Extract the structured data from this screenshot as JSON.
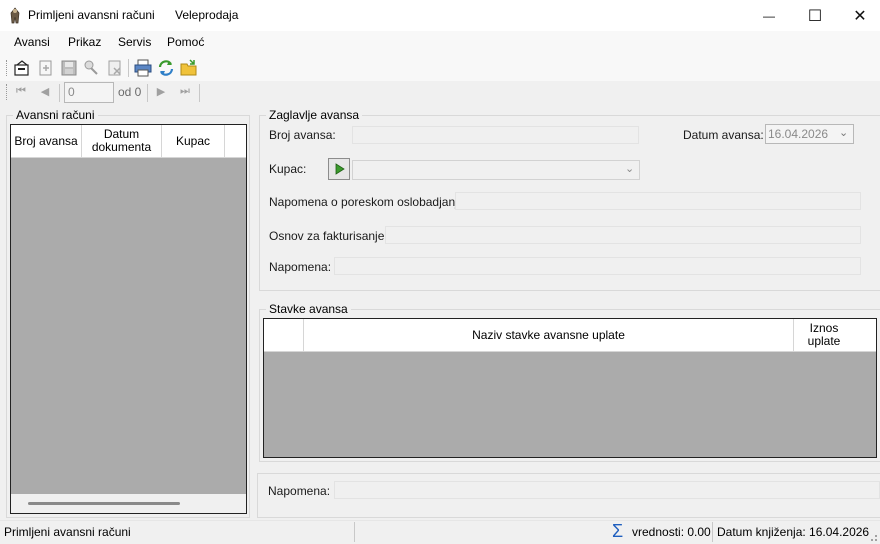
{
  "window": {
    "title": "Primljeni avansni računi",
    "subtitle": "Veleprodaja",
    "minimize_glyph": "—",
    "maximize_glyph": "☐",
    "close_glyph": "✕"
  },
  "menu": {
    "items": [
      {
        "label": "Avansi"
      },
      {
        "label": "Prikaz"
      },
      {
        "label": "Servis"
      },
      {
        "label": "Pomoć"
      }
    ]
  },
  "toolbar": {
    "icons": [
      "new-document-icon",
      "add-icon",
      "save-icon",
      "search-key-icon",
      "delete-icon",
      "print-icon",
      "refresh-icon",
      "open-folder-icon"
    ],
    "accent_blue": "#2b6fc2",
    "accent_green": "#3a9a2c",
    "accent_yellow": "#e8b82a"
  },
  "navigator": {
    "position_value": "0",
    "of_label": "od 0"
  },
  "left_panel": {
    "title": "Avansni računi",
    "columns": [
      "Broj avansa",
      "Datum dokumenta",
      "Kupac"
    ]
  },
  "header_group": {
    "title": "Zaglavlje avansa",
    "broj_label": "Broj avansa:",
    "broj_value": "",
    "datum_label": "Datum avansa:",
    "datum_value": "16.04.2026",
    "kupac_label": "Kupac:",
    "kupac_value": "",
    "napomena_porez_label": "Napomena o poreskom oslobadjanju:",
    "osnov_label": "Osnov za fakturisanje:",
    "napomena_label": "Napomena:"
  },
  "items_group": {
    "title": "Stavke avansa",
    "columns": [
      "",
      "Naziv stavke avansne uplate",
      "Iznos uplate"
    ]
  },
  "bottom": {
    "napomena_label": "Napomena:"
  },
  "status": {
    "left_text": "Primljeni avansni računi",
    "sum_text": "vrednosti: 0.00",
    "date_text": "Datum knjiženja: 16.04.2026",
    "sum_icon_color": "#1f5fbf"
  }
}
